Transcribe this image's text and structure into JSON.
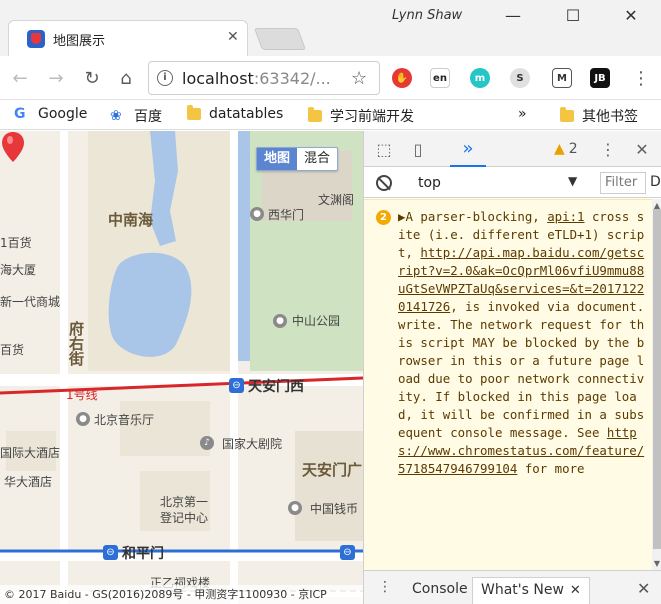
{
  "window": {
    "profile_name": "Lynn Shaw",
    "minimize": "—",
    "maximize": "☐",
    "close": "✕"
  },
  "tab": {
    "title": "地图展示",
    "close": "✕"
  },
  "toolbar": {
    "url_host": "localhost",
    "url_rest": ":63342/...",
    "back": "←",
    "forward": "→",
    "reload": "↻",
    "home": "⌂",
    "star": "☆",
    "menu": "⋮"
  },
  "extensions": {
    "ext2_text": "en",
    "ext4_text": "S",
    "ext6_text": "JB"
  },
  "bookmarks": {
    "items": [
      "Google",
      "百度",
      "datatables",
      "学习前端开发"
    ],
    "overflow": "»",
    "other": "其他书签"
  },
  "map": {
    "type_buttons": [
      "地图",
      "混合"
    ],
    "active_type": "地图",
    "labels": {
      "zhongnanhai": "中南海",
      "xihuamen": "西华门",
      "wenyuange": "文渊阁",
      "zhongshan_park": "中山公园",
      "fuyoujie": "府右街",
      "tiananmen_west": "天安门西",
      "line1": "1号线",
      "concert_hall": "北京音乐厅",
      "theatre": "国家大剧院",
      "tiananmen": "天安门广",
      "beijing_no1": "北京第一",
      "registry": "登记中心",
      "qianmen": "中国钱币",
      "hepingmen": "和平门",
      "left_1": "1百货",
      "left_2": "海大厦",
      "left_3": "新一代商城",
      "left_4": "百货",
      "left_5": "国际大酒店",
      "left_6": "华大酒店",
      "bottom_1": "正乙祠戏楼"
    },
    "copyright": "© 2017 Baidu - GS(2016)2089号 - 甲测资字1100930 - 京ICP"
  },
  "devtools": {
    "chevron": "»",
    "warning_count": "2",
    "menu": "⋮",
    "close": "✕",
    "context": "top",
    "filter_placeholder": "Filter",
    "filter_more": "D",
    "message_count": "2",
    "message": {
      "prefix": "▶A parser-blocking, ",
      "source_link": "api:1",
      "part1": " cross site (i.e. different eTLD+1) script, ",
      "script_link": "http://api.map.baidu.com/getscript?v=2.0&ak=OcQprMl06vfiU9mmu88uGtSeVWPZTaUq&services=&t=20171220141726",
      "part2": ", is invoked via document.write. The network request for this script MAY be blocked by the browser in this or a future page load due to poor network connectivity. If blocked in this page load, it will be confirmed in a subsequent console message. See ",
      "feature_link": "https://www.chromestatus.com/feature/5718547946799104",
      "part3": " for more"
    },
    "drawer_menu": "⋮",
    "drawer_tabs": [
      "Console",
      "What's New"
    ],
    "drawer_tab_close": "✕",
    "drawer_close": "✕"
  },
  "colors": {
    "accent": "#1a73e8",
    "warning_bg": "#fffbe5",
    "warning_text": "#5c3b00",
    "map_water": "#a9c5e8",
    "map_green": "#cfe3c2",
    "metro_line1": "#d8262a",
    "metro_line2": "#2d6fd6"
  }
}
